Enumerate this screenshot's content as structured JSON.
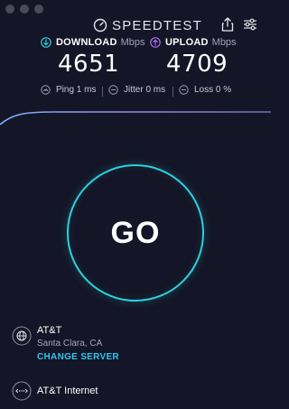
{
  "header": {
    "brand": "SPEEDTEST",
    "brand_icon": "speedometer-icon",
    "share_icon": "share-icon",
    "settings_icon": "sliders-icon"
  },
  "results": {
    "download": {
      "label": "DOWNLOAD",
      "unit": "Mbps",
      "value": "4651",
      "icon": "download-arrow-icon",
      "color": "#2fd0dd"
    },
    "upload": {
      "label": "UPLOAD",
      "unit": "Mbps",
      "value": "4709",
      "icon": "upload-arrow-icon",
      "color": "#a872f0"
    }
  },
  "stats": {
    "ping": "Ping 1 ms",
    "jitter": "Jitter 0 ms",
    "loss": "Loss 0 %"
  },
  "go_button": {
    "label": "GO",
    "ring_color": "#2fd0dd"
  },
  "server": {
    "name": "AT&T",
    "location": "Santa Clara, CA",
    "change_label": "CHANGE SERVER",
    "icon": "globe-icon"
  },
  "isp": {
    "name": "AT&T Internet",
    "icon": "connection-icon"
  },
  "colors": {
    "background": "#141526",
    "accent": "#2fd0dd",
    "link": "#2fc7f0"
  }
}
